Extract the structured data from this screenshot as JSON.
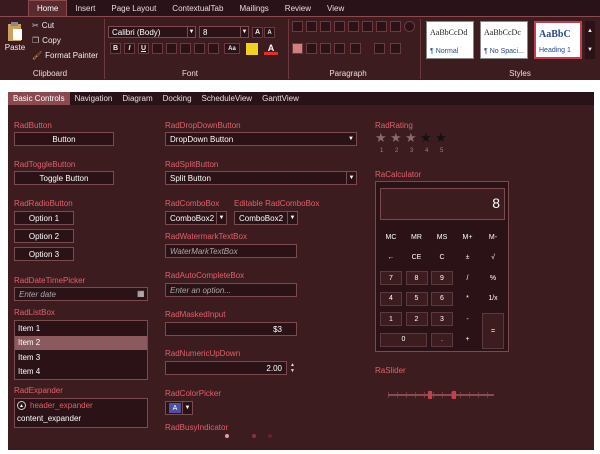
{
  "ribbon": {
    "tabs": [
      "",
      "Home",
      "Insert",
      "Page Layout",
      "ContextualTab",
      "Mailings",
      "Review",
      "View"
    ],
    "clipboard": {
      "paste": "Paste",
      "cut": "Cut",
      "copy": "Copy",
      "format_painter": "Format Painter",
      "label": "Clipboard"
    },
    "font": {
      "family": "Calibri (Body)",
      "size": "8",
      "label": "Font",
      "bold": "B",
      "italic": "I",
      "underline": "U",
      "grow": "A",
      "shrink": "A",
      "case": "Aa"
    },
    "paragraph": {
      "label": "Paragraph"
    },
    "styles": {
      "label": "Styles",
      "items": [
        {
          "sample": "AaBbCcDd",
          "name": "¶ Normal"
        },
        {
          "sample": "AaBbCcDc",
          "name": "¶ No Spaci..."
        },
        {
          "sample": "AaBbC",
          "name": "Heading 1"
        }
      ]
    }
  },
  "tabs": [
    "Basic Controls",
    "Navigation",
    "Diagram",
    "Docking",
    "ScheduleView",
    "GanttView"
  ],
  "col1": {
    "button_label": "RadButton",
    "button_text": "Button",
    "toggle_label": "RadToggleButton",
    "toggle_text": "Toggle Button",
    "radio_label": "RadRadioButton",
    "radio_options": [
      "Option 1",
      "Option 2",
      "Option 3"
    ],
    "date_label": "RadDateTimePicker",
    "date_placeholder": "Enter date",
    "listbox_label": "RadListBox",
    "list_items": [
      "Item 1",
      "Item 2",
      "Item 3",
      "Item 4"
    ],
    "expander_label": "RadExpander",
    "expander_header": "header_expander",
    "expander_content": "content_expander"
  },
  "col2": {
    "dropdown_label": "RadDropDownButton",
    "dropdown_text": "DropDown Button",
    "split_label": "RadSplitButton",
    "split_text": "Split Button",
    "combo_label": "RadComboBox",
    "combo_value": "ComboBox2",
    "ecombo_label": "Editable RadComboBox",
    "ecombo_value": "ComboBox2",
    "watermark_label": "RadWatermarkTextBox",
    "watermark_placeholder": "WaterMarkTextBox",
    "autocomplete_label": "RadAutoCompleteBox",
    "autocomplete_placeholder": "Enter an option...",
    "masked_label": "RadMaskedInput",
    "masked_value": "$3",
    "numeric_label": "RadNumericUpDown",
    "numeric_value": "2.00",
    "color_label": "RadColorPicker",
    "color_glyph": "A",
    "busy_label": "RadBusyIndicator"
  },
  "col3": {
    "rating_label": "RadRating",
    "stars": [
      "★",
      "★",
      "★",
      "★",
      "★"
    ],
    "star_numbers": [
      "1",
      "2",
      "3",
      "4",
      "5"
    ],
    "rating_value": 3,
    "calc_label": "RaCalculator",
    "calc_display": "8",
    "calc_keys": [
      [
        "MC",
        "MR",
        "MS",
        "M+",
        "M-"
      ],
      [
        "←",
        "CE",
        "C",
        "±",
        "√"
      ],
      [
        "7",
        "8",
        "9",
        "/",
        "%"
      ],
      [
        "4",
        "5",
        "6",
        "*",
        "1/x"
      ],
      [
        "1",
        "2",
        "3",
        "-",
        ""
      ],
      [
        "0",
        "",
        ".",
        "+",
        ""
      ]
    ],
    "calc_equals": "=",
    "slider_label": "RaSlider"
  },
  "colors": {
    "accent": "#e0606a",
    "panel": "#3d1c20",
    "field": "#2a1216",
    "border": "#7a4a4f"
  }
}
